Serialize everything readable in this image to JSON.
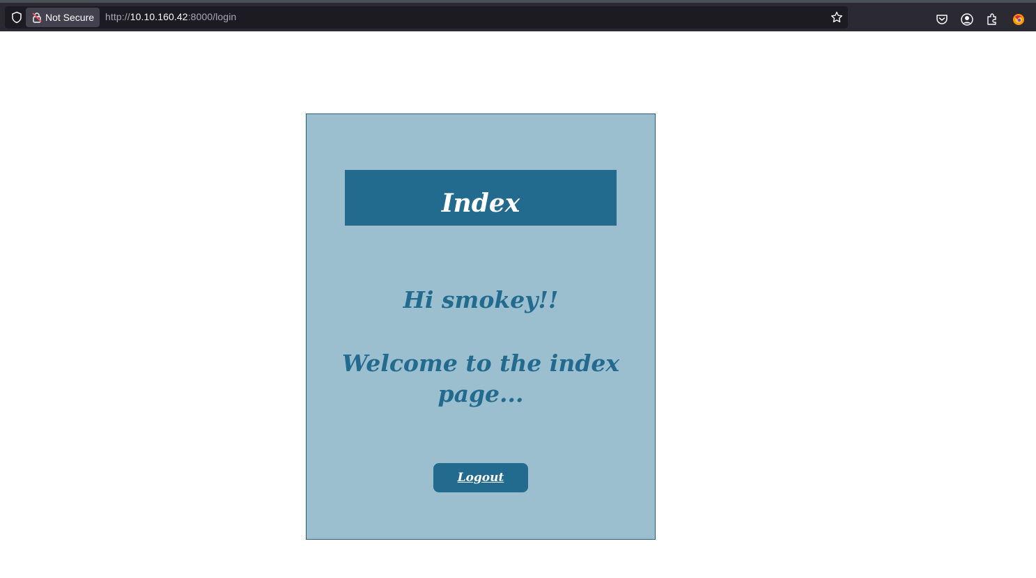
{
  "browser": {
    "security_label": "Not Secure",
    "url_prefix": "http://",
    "url_host": "10.10.160.42",
    "url_suffix": ":8000/login",
    "icons": [
      "shield-icon",
      "lock-warning-icon",
      "bookmark-star-icon",
      "pocket-icon",
      "account-icon",
      "extensions-icon",
      "firefox-menu-icon"
    ]
  },
  "page": {
    "header_title": "Index",
    "greeting": "Hi smokey!!",
    "welcome_message": "Welcome to the index page...",
    "logout_label": "Logout"
  },
  "colors": {
    "card_bg": "#9bbfcf",
    "accent": "#226a8e",
    "header_text": "#ffffff"
  }
}
